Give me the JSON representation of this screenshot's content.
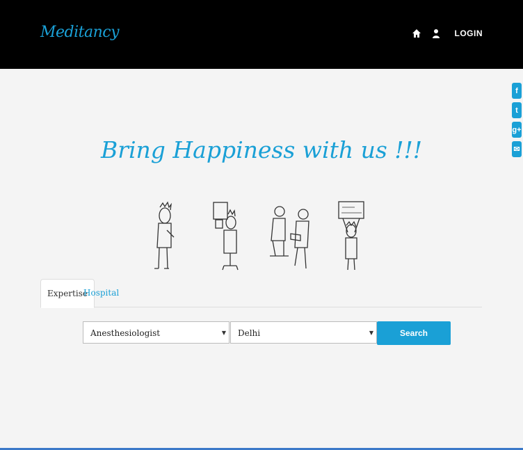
{
  "header": {
    "logo": "Meditancy",
    "login_label": "LOGIN",
    "icons": [
      "home-icon",
      "user-icon"
    ]
  },
  "social": [
    {
      "name": "facebook-icon",
      "glyph": "f"
    },
    {
      "name": "twitter-icon",
      "glyph": "t"
    },
    {
      "name": "google-plus-icon",
      "glyph": "g+"
    },
    {
      "name": "email-icon",
      "glyph": "✉"
    }
  ],
  "hero": {
    "headline": "Bring Happiness with us !!!"
  },
  "tabs": [
    {
      "label": "Expertise",
      "active": true
    },
    {
      "label": "Hospital",
      "active": false
    }
  ],
  "search": {
    "expertise_value": "Anesthesiologist",
    "location_value": "Delhi",
    "button_label": "Search"
  },
  "colors": {
    "accent": "#1aa0d6",
    "header_bg": "#000000",
    "page_bg": "#f4f4f4"
  }
}
